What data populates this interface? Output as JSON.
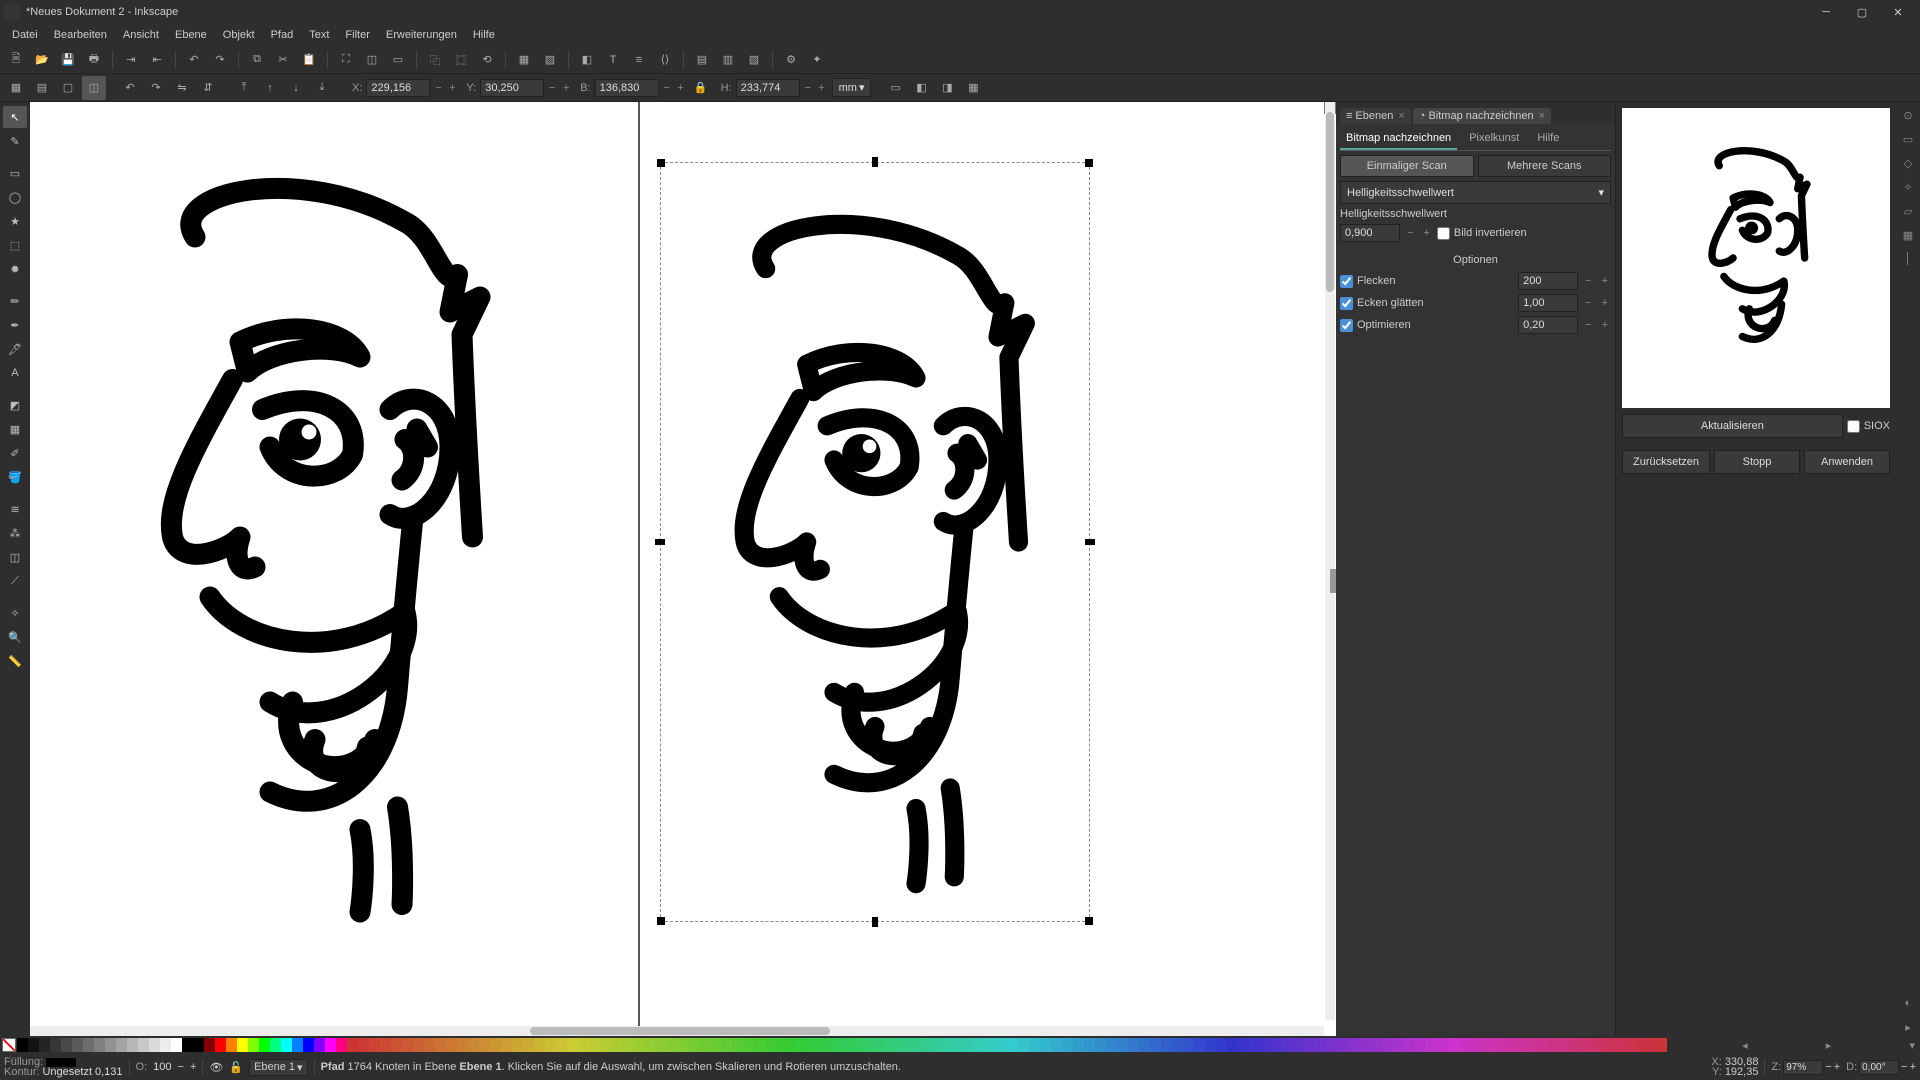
{
  "title": "*Neues Dokument 2 - Inkscape",
  "menu": [
    "Datei",
    "Bearbeiten",
    "Ansicht",
    "Ebene",
    "Objekt",
    "Pfad",
    "Text",
    "Filter",
    "Erweiterungen",
    "Hilfe"
  ],
  "coords": {
    "x_label": "X:",
    "x": "229,156",
    "y_label": "Y:",
    "y": "30,250",
    "b_label": "B:",
    "b": "136,830",
    "h_label": "H:",
    "h": "233,774",
    "unit": "mm"
  },
  "dock": {
    "tab_layers": "Ebenen",
    "tab_trace": "Bitmap nachzeichnen"
  },
  "trace_panel": {
    "tab_trace": "Bitmap nachzeichnen",
    "tab_pixel": "Pixelkunst",
    "tab_help": "Hilfe",
    "subtab_single": "Einmaliger Scan",
    "subtab_multi": "Mehrere Scans",
    "mode": "Helligkeitsschwellwert",
    "threshold_label": "Helligkeitsschwellwert",
    "threshold_value": "0,900",
    "invert_label": "Bild invertieren",
    "options_title": "Optionen",
    "opt_speckles_label": "Flecken",
    "opt_speckles_value": "200",
    "opt_smooth_label": "Ecken glätten",
    "opt_smooth_value": "1,00",
    "opt_optimize_label": "Optimieren",
    "opt_optimize_value": "0,20",
    "btn_update": "Aktualisieren",
    "chk_siox": "SIOX",
    "btn_reset": "Zurücksetzen",
    "btn_stop": "Stopp",
    "btn_apply": "Anwenden"
  },
  "status": {
    "fill_label": "Füllung:",
    "stroke_label": "Kontur:",
    "stroke_value": "Ungesetzt",
    "stroke_width": "0,131",
    "opacity_label": "O:",
    "opacity_value": "100",
    "layer": "Ebene 1",
    "msg_prefix": "Pfad",
    "msg_nodes": "1764 Knoten in Ebene",
    "msg_layer": "Ebene 1",
    "msg_suffix": ". Klicken Sie auf die Auswahl, um zwischen Skalieren und Rotieren umzuschalten.",
    "cursor_x_label": "X:",
    "cursor_x": "330,88",
    "cursor_y_label": "Y:",
    "cursor_y": "192,35",
    "zoom_label": "Z:",
    "zoom": "97%",
    "rot_label": "D:",
    "rot": "0,00°"
  }
}
